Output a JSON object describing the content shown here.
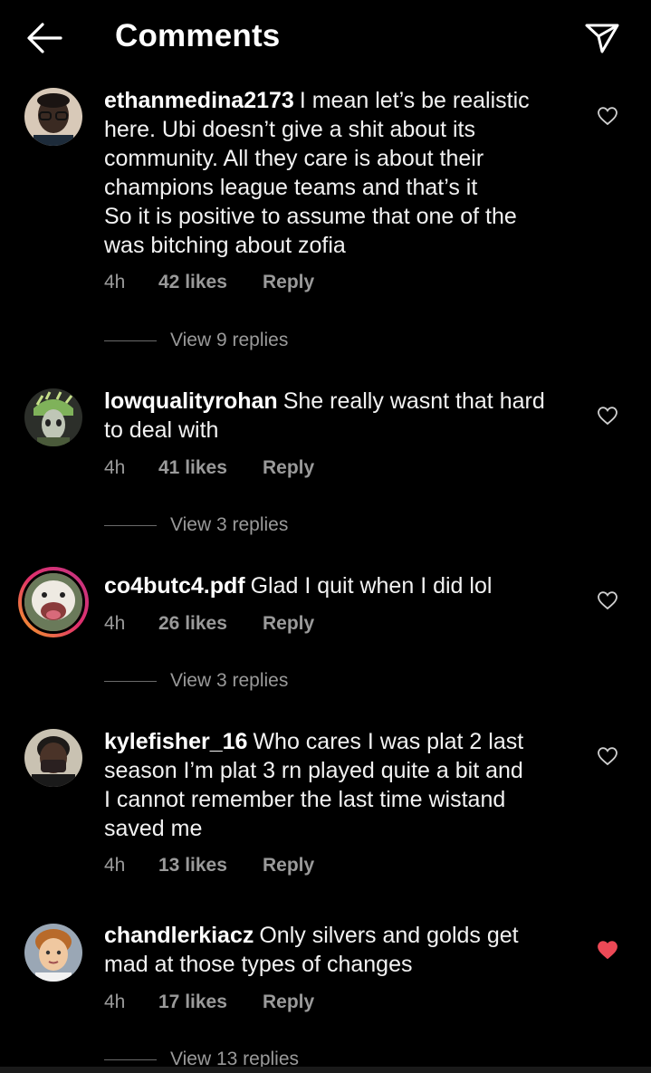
{
  "header": {
    "title": "Comments"
  },
  "comments": [
    {
      "username": "ethanmedina2173",
      "lines": [
        "I mean let’s be realistic",
        "here. Ubi doesn’t give a shit about its",
        "community. All they care is about their",
        "champions league teams and that’s it",
        "So it is positive to assume that one of the",
        "was bitching about zofia"
      ],
      "time": "4h",
      "likes": "42 likes",
      "reply": "Reply",
      "view_replies": "View 9 replies",
      "liked": false
    },
    {
      "username": "lowqualityrohan",
      "lines": [
        "She really wasnt that hard",
        "to deal with"
      ],
      "time": "4h",
      "likes": "41 likes",
      "reply": "Reply",
      "view_replies": "View 3 replies",
      "liked": false
    },
    {
      "username": "co4butc4.pdf",
      "lines": [
        "Glad I quit when I did lol"
      ],
      "time": "4h",
      "likes": "26 likes",
      "reply": "Reply",
      "view_replies": "View 3 replies",
      "liked": false
    },
    {
      "username": "kylefisher_16",
      "lines": [
        "Who cares I was plat 2 last",
        "season I’m plat 3 rn played quite a bit and",
        "I cannot remember the last time wistand",
        "saved me"
      ],
      "time": "4h",
      "likes": "13 likes",
      "reply": "Reply",
      "view_replies": "",
      "liked": false
    },
    {
      "username": "chandlerkiacz",
      "lines": [
        "Only silvers and golds get",
        "mad at those types of changes"
      ],
      "time": "4h",
      "likes": "17 likes",
      "reply": "Reply",
      "view_replies": "View 13 replies",
      "liked": true
    }
  ],
  "colors": {
    "background": "#000000",
    "text": "#f2f2f2",
    "muted": "#9a9a9a",
    "liked_heart": "#ed4956"
  },
  "icons": {
    "back": "arrow-left-icon",
    "send": "paper-plane-icon",
    "like": "heart-outline-icon",
    "liked": "heart-filled-icon"
  }
}
